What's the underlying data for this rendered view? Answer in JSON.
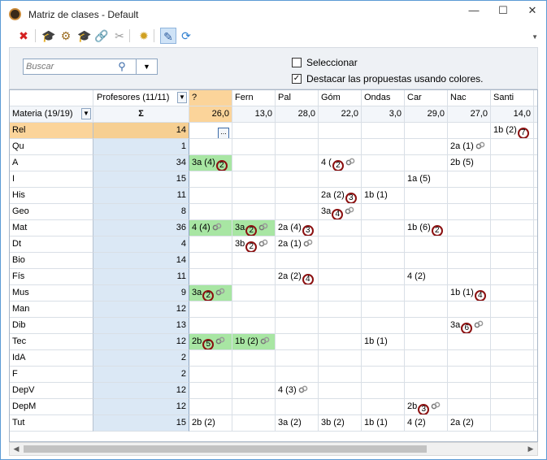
{
  "window": {
    "title": "Matriz de clases - Default",
    "controls": {
      "minimize": "—",
      "maximize": "☐",
      "close": "✕"
    }
  },
  "toolbar": {
    "tools": [
      {
        "name": "delete-icon",
        "glyph": "✖",
        "color": "#d42020"
      },
      {
        "name": "teacher-hat-icon",
        "glyph": "🎓",
        "color": "#8a8a8a"
      },
      {
        "name": "teacher-settings-icon",
        "glyph": "⚙",
        "color": "#9a6b20"
      },
      {
        "name": "teacher-hat-blue-icon",
        "glyph": "🎓",
        "color": "#2f5e9e"
      },
      {
        "name": "link-icon",
        "glyph": "🔗",
        "color": "#7a7a7a"
      },
      {
        "name": "unlink-icon",
        "glyph": "✂",
        "color": "#9a9a9a"
      },
      {
        "name": "gear-icon",
        "glyph": "✹",
        "color": "#d0a020"
      },
      {
        "name": "highlight-toggle-icon",
        "glyph": "✎",
        "color": "#2f5e9e"
      },
      {
        "name": "refresh-icon",
        "glyph": "⟳",
        "color": "#2f7fd0"
      }
    ]
  },
  "filters": {
    "search_placeholder": "Buscar",
    "select_label": "Seleccionar",
    "select_checked": false,
    "highlight_label": "Destacar las propuestas usando colores.",
    "highlight_checked": true
  },
  "grid": {
    "teachers_header": "Profesores (11/11)",
    "subjects_header": "Materia (19/19)",
    "sigma": "Σ",
    "columns": [
      {
        "name": "?",
        "total": "26,0"
      },
      {
        "name": "Fern",
        "total": "13,0"
      },
      {
        "name": "Pal",
        "total": "28,0"
      },
      {
        "name": "Góm",
        "total": "22,0"
      },
      {
        "name": "Ondas",
        "total": "3,0"
      },
      {
        "name": "Car",
        "total": "29,0"
      },
      {
        "name": "Nac",
        "total": "27,0"
      },
      {
        "name": "Santi",
        "total": "14,0"
      }
    ],
    "rows": [
      {
        "subject": "Rel",
        "count": "14",
        "selected": true,
        "cells": [
          {
            "col": 0,
            "text": "",
            "button": "..."
          },
          {
            "col": 7,
            "text": "1b (2)",
            "badge": "7"
          }
        ]
      },
      {
        "subject": "Qu",
        "count": "1",
        "cells": [
          {
            "col": 6,
            "text": "2a (1)",
            "link": true
          }
        ]
      },
      {
        "subject": "A",
        "count": "34",
        "cells": [
          {
            "col": 0,
            "text": "3a (4)",
            "badge": "2",
            "green": true
          },
          {
            "col": 3,
            "text": "4 (",
            "badge": "2",
            "link": true
          },
          {
            "col": 6,
            "text": "2b (5)"
          }
        ]
      },
      {
        "subject": "I",
        "count": "15",
        "cells": [
          {
            "col": 5,
            "text": "1a (5)"
          }
        ]
      },
      {
        "subject": "His",
        "count": "11",
        "cells": [
          {
            "col": 3,
            "text": "2a (2)",
            "badge": "3"
          },
          {
            "col": 4,
            "text": "1b (1)"
          }
        ]
      },
      {
        "subject": "Geo",
        "count": "8",
        "cells": [
          {
            "col": 3,
            "text": "3a",
            "badge": "4",
            "link": true
          }
        ]
      },
      {
        "subject": "Mat",
        "count": "36",
        "cells": [
          {
            "col": 0,
            "text": "4 (4)",
            "link": true,
            "green": true
          },
          {
            "col": 1,
            "text": "3a",
            "badge": "2",
            "link": true,
            "green": true
          },
          {
            "col": 2,
            "text": "2a (4)",
            "badge": "3"
          },
          {
            "col": 5,
            "text": "1b (6)",
            "badge": "2"
          }
        ]
      },
      {
        "subject": "Dt",
        "count": "4",
        "cells": [
          {
            "col": 1,
            "text": "3b",
            "badge": "2",
            "link": true
          },
          {
            "col": 2,
            "text": "2a (1)",
            "link": true
          }
        ]
      },
      {
        "subject": "Bio",
        "count": "14",
        "cells": []
      },
      {
        "subject": "Fís",
        "count": "11",
        "cells": [
          {
            "col": 2,
            "text": "2a (2)",
            "badge": "4"
          },
          {
            "col": 5,
            "text": "4 (2)"
          }
        ]
      },
      {
        "subject": "Mus",
        "count": "9",
        "cells": [
          {
            "col": 0,
            "text": "3a",
            "badge": "2",
            "link": true,
            "green": true
          },
          {
            "col": 6,
            "text": "1b (1)",
            "badge": "4"
          }
        ]
      },
      {
        "subject": "Man",
        "count": "12",
        "cells": []
      },
      {
        "subject": "Dib",
        "count": "13",
        "cells": [
          {
            "col": 6,
            "text": "3a",
            "badge": "6",
            "link": true
          }
        ]
      },
      {
        "subject": "Tec",
        "count": "12",
        "cells": [
          {
            "col": 0,
            "text": "2b",
            "badge": "5",
            "link": true,
            "green": true
          },
          {
            "col": 1,
            "text": "1b (2)",
            "link": true,
            "green": true
          },
          {
            "col": 4,
            "text": "1b (1)"
          }
        ]
      },
      {
        "subject": "IdA",
        "count": "2",
        "cells": []
      },
      {
        "subject": "F",
        "count": "2",
        "cells": []
      },
      {
        "subject": "DepV",
        "count": "12",
        "cells": [
          {
            "col": 2,
            "text": "4 (3)",
            "link": true
          }
        ]
      },
      {
        "subject": "DepM",
        "count": "12",
        "cells": [
          {
            "col": 5,
            "text": "2b",
            "badge": "3",
            "link": true
          }
        ]
      },
      {
        "subject": "Tut",
        "count": "15",
        "cells": [
          {
            "col": 0,
            "text": "2b (2)"
          },
          {
            "col": 2,
            "text": "3a (2)"
          },
          {
            "col": 3,
            "text": "3b (2)"
          },
          {
            "col": 4,
            "text": "1b (1)"
          },
          {
            "col": 5,
            "text": "4 (2)"
          },
          {
            "col": 6,
            "text": "2a (2)"
          }
        ]
      }
    ]
  },
  "colors": {
    "selected_row": "#fbd49a",
    "proposal_green": "#a8e6a3",
    "count_column": "#dbe8f5",
    "badge_ring": "#8b1010"
  }
}
